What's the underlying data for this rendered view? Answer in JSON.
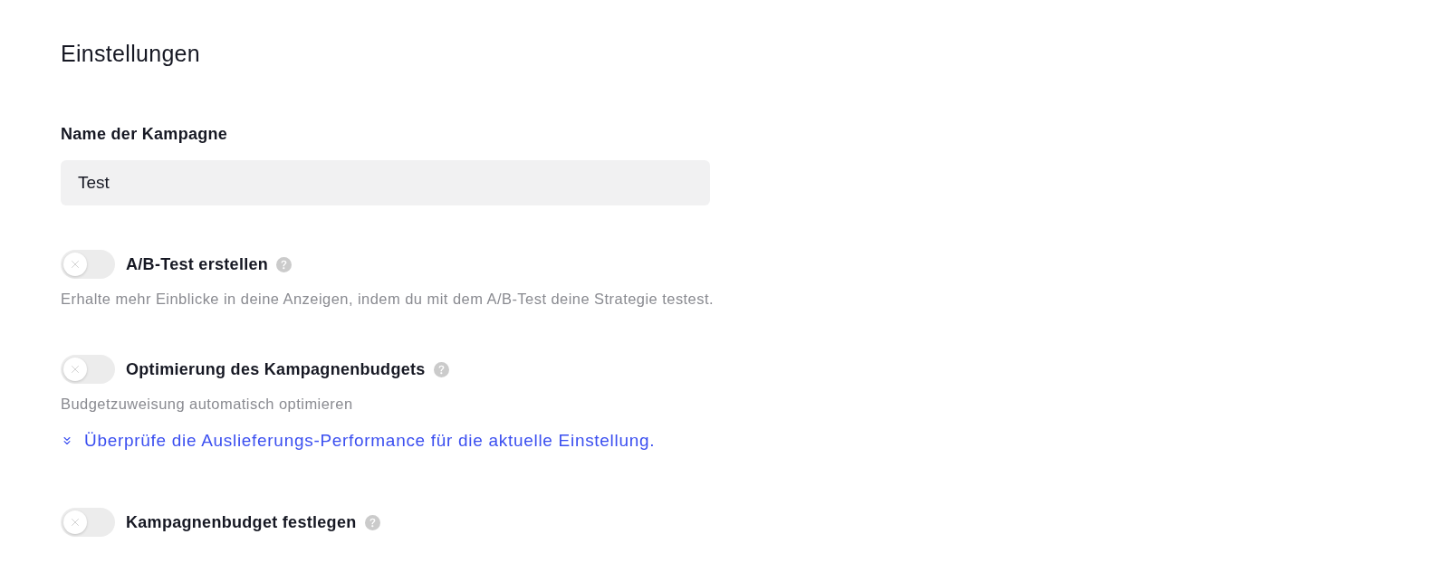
{
  "title": "Einstellungen",
  "campaign_name": {
    "label": "Name der Kampagne",
    "value": "Test"
  },
  "settings": [
    {
      "label": "A/B-Test erstellen",
      "on": false,
      "description": "Erhalte mehr Einblicke in deine Anzeigen, indem du mit dem A/B-Test deine Strategie testest."
    },
    {
      "label": "Optimierung des Kampagnenbudgets",
      "on": false,
      "description": "Budgetzuweisung automatisch optimieren",
      "link": "Überprüfe die Auslieferungs-Performance für die aktuelle Einstellung."
    },
    {
      "label": "Kampagnenbudget festlegen",
      "on": false
    }
  ]
}
